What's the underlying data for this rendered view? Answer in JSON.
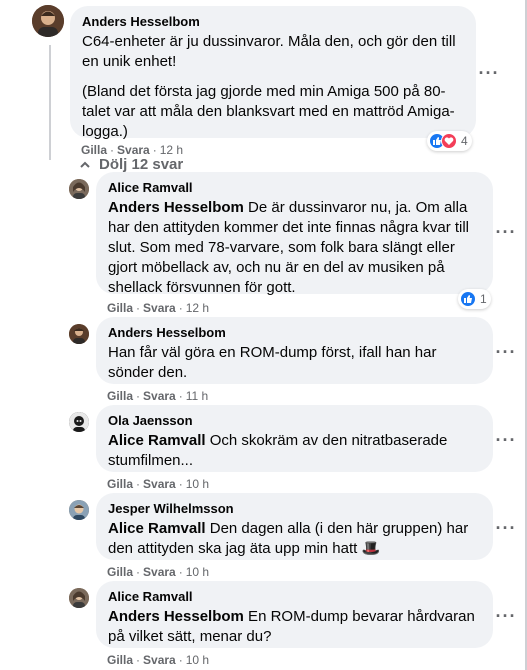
{
  "colors": {
    "bubble": "#f0f2f5",
    "meta": "#65676b",
    "like_blue": "#1877f2",
    "love_red": "#f33e58"
  },
  "comments": [
    {
      "author": "Anders Hesselbom",
      "paragraphs": [
        "C64-enheter är ju dussinvaror. Måla den, och gör den till en unik enhet!",
        "(Bland det första jag gjorde med min Amiga 500 på 80-talet var att måla den blanksvart med en mattröd Amiga-logga.)"
      ],
      "like": "Gilla",
      "reply": "Svara",
      "time": "12 h",
      "reactions": {
        "icons": [
          "like-icon",
          "love-icon"
        ],
        "count": "4"
      }
    }
  ],
  "thread_toggle": "Dölj 12 svar",
  "replies": [
    {
      "author": "Alice Ramvall",
      "mention": "Anders Hesselbom",
      "text": " De är dussinvaror nu, ja. Om alla har den attityden kommer det inte finnas några kvar till slut. Som med 78-varvare, som folk bara slängt eller gjort möbellack av, och nu är en del av musiken på shellack försvunnen för gott.",
      "like": "Gilla",
      "reply": "Svara",
      "time": "12 h",
      "reactions": {
        "icons": [
          "like-icon"
        ],
        "count": "1"
      }
    },
    {
      "author": "Anders Hesselbom",
      "mention": "",
      "text": "Han får väl göra en ROM-dump först, ifall han har sönder den.",
      "like": "Gilla",
      "reply": "Svara",
      "time": "11 h"
    },
    {
      "author": "Ola Jaensson",
      "mention": "Alice Ramvall",
      "text": " Och skokräm av den nitratbaserade stumfilmen...",
      "like": "Gilla",
      "reply": "Svara",
      "time": "10 h"
    },
    {
      "author": "Jesper Wilhelmsson",
      "mention": "Alice Ramvall",
      "text": " Den dagen alla (i den här gruppen) har den attityden ska jag äta upp min hatt 🎩",
      "like": "Gilla",
      "reply": "Svara",
      "time": "10 h"
    },
    {
      "author": "Alice Ramvall",
      "mention": "Anders Hesselbom",
      "text": " En ROM-dump bevarar hårdvaran på vilket sätt, menar du?",
      "like": "Gilla",
      "reply": "Svara",
      "time": "10 h"
    }
  ],
  "more_glyph": "···"
}
